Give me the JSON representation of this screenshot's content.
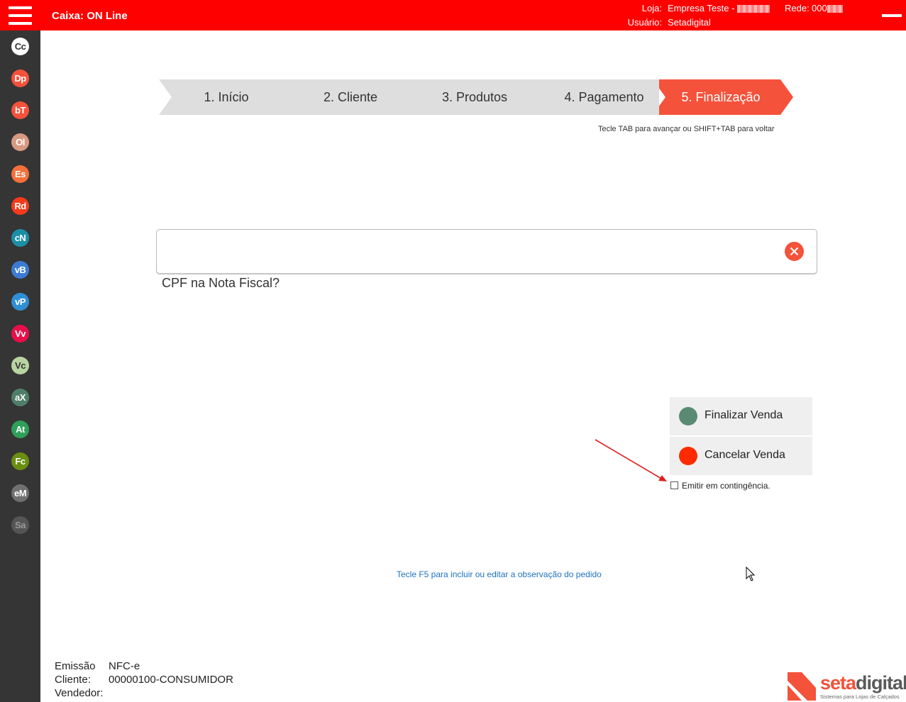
{
  "header": {
    "title": "Caixa: ON Line",
    "loja_label": "Loja:",
    "loja_value": "Empresa Teste -",
    "rede_label": "Rede:",
    "rede_value": "000",
    "usuario_label": "Usuário:",
    "usuario_value": "Setadigital",
    "bar_color": "#ff0000"
  },
  "sidebar": {
    "items": [
      {
        "label": "Cc",
        "color": "#ffffff",
        "text_color": "#333333"
      },
      {
        "label": "Dp",
        "color": "#f4523b"
      },
      {
        "label": "bT",
        "color": "#f4523b"
      },
      {
        "label": "Ol",
        "color": "#d89a82"
      },
      {
        "label": "Es",
        "color": "#f4703b"
      },
      {
        "label": "Rd",
        "color": "#f43b1b"
      },
      {
        "label": "cN",
        "color": "#1c8fa8"
      },
      {
        "label": "vB",
        "color": "#3b7bd4"
      },
      {
        "label": "vP",
        "color": "#2f8fd4"
      },
      {
        "label": "Vv",
        "color": "#e8104a"
      },
      {
        "label": "Vc",
        "color": "#b8d4a0",
        "text_color": "#333333"
      },
      {
        "label": "aX",
        "color": "#4f7f6a"
      },
      {
        "label": "At",
        "color": "#2f9f5a"
      },
      {
        "label": "Fc",
        "color": "#6a8f10"
      },
      {
        "label": "eM",
        "color": "#707070"
      },
      {
        "label": "Sa",
        "color": "#555555",
        "text_color": "#9a9a9a"
      }
    ]
  },
  "steps": {
    "items": [
      "1. Início",
      "2. Cliente",
      "3. Produtos",
      "4. Pagamento",
      "5. Finalização"
    ],
    "active_index": 4,
    "hint": "Tecle TAB para avançar ou SHIFT+TAB para voltar"
  },
  "cpf": {
    "value": "",
    "label": "CPF na Nota Fiscal?"
  },
  "actions": {
    "finalizar_label": "Finalizar Venda",
    "finalizar_color": "#5a8a72",
    "cancelar_label": "Cancelar Venda",
    "cancelar_color": "#ff2a00",
    "contingencia_label": "Emitir em contingência.",
    "contingencia_checked": false
  },
  "f5_hint": "Tecle F5 para incluir ou editar a observação do pedido",
  "footer": {
    "emissao_label": "Emissão",
    "emissao_value": "NFC-e",
    "cliente_label": "Cliente:",
    "cliente_value": "00000100-CONSUMIDOR",
    "vendedor_label": "Vendedor:",
    "vendedor_value": ""
  },
  "logo": {
    "part1": "seta",
    "part2": "digital",
    "subtitle": "Sistemas para Lojas de Calçados"
  },
  "accent_color": "#f4523b"
}
